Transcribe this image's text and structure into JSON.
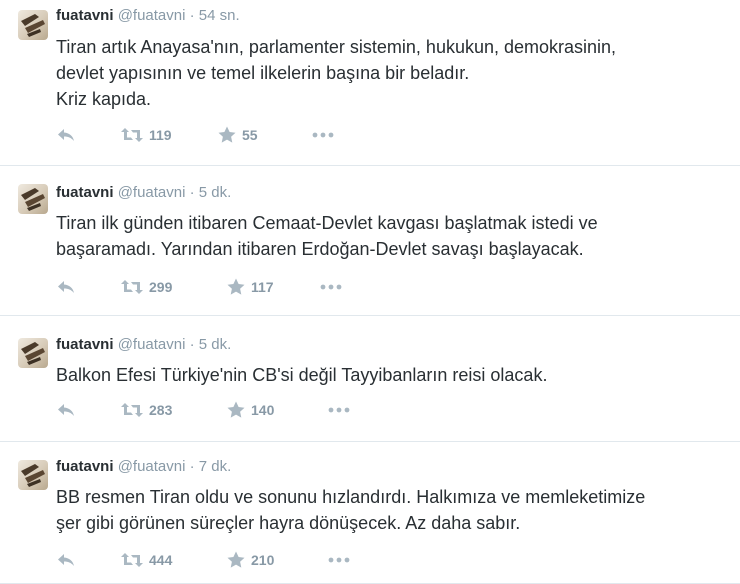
{
  "tweets": [
    {
      "name": "fuatavni",
      "handle": "@fuatavni",
      "separator": "·",
      "time": "54 sn.",
      "text_lines": [
        "Tiran artık Anayasa'nın, parlamenter sistemin, hukukun, demokrasinin,",
        "devlet yapısının ve temel ilkelerin başına bir beladır.",
        "Kriz kapıda."
      ],
      "retweets": "119",
      "favorites": "55"
    },
    {
      "name": "fuatavni",
      "handle": "@fuatavni",
      "separator": "·",
      "time": "5 dk.",
      "text_lines": [
        "Tiran ilk günden itibaren Cemaat-Devlet kavgası başlatmak istedi ve",
        "başaramadı. Yarından itibaren Erdoğan-Devlet savaşı başlayacak."
      ],
      "retweets": "299",
      "favorites": "117"
    },
    {
      "name": "fuatavni",
      "handle": "@fuatavni",
      "separator": "·",
      "time": "5 dk.",
      "text_lines": [
        "Balkon Efesi Türkiye'nin CB'si değil Tayyibanların reisi olacak."
      ],
      "retweets": "283",
      "favorites": "140"
    },
    {
      "name": "fuatavni",
      "handle": "@fuatavni",
      "separator": "·",
      "time": "7 dk.",
      "text_lines": [
        "BB resmen Tiran oldu ve sonunu hızlandırdı. Halkımıza ve memleketimize",
        "şer gibi görünen süreçler hayra dönüşecek. Az daha sabır."
      ],
      "retweets": "444",
      "favorites": "210"
    }
  ],
  "icons": {
    "reply": "reply-icon",
    "retweet": "retweet-icon",
    "favorite": "star-icon",
    "more": "more-icon"
  },
  "colors": {
    "text": "#292f33",
    "muted": "#8899a6",
    "icon": "#aab8c2",
    "divider": "#e1e8ed"
  }
}
